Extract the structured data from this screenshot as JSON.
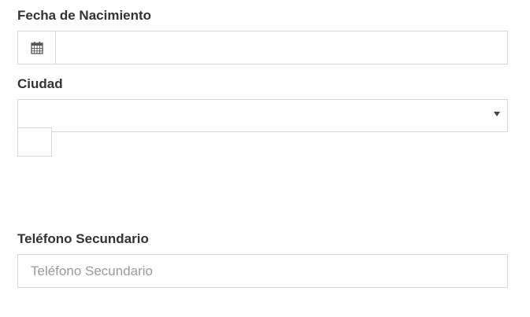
{
  "form": {
    "birth_date": {
      "label": "Fecha de Nacimiento",
      "value": "",
      "icon": "calendar-icon"
    },
    "city": {
      "label": "Ciudad",
      "selected_value": "",
      "icon": "caret-down-icon"
    },
    "secondary_phone": {
      "label": "Teléfono Secundario",
      "value": "",
      "placeholder": "Teléfono Secundario"
    }
  },
  "colors": {
    "border": "#d9d9d9",
    "label_text": "#333333",
    "placeholder_text": "#9a9a9a",
    "icon": "#555555"
  }
}
